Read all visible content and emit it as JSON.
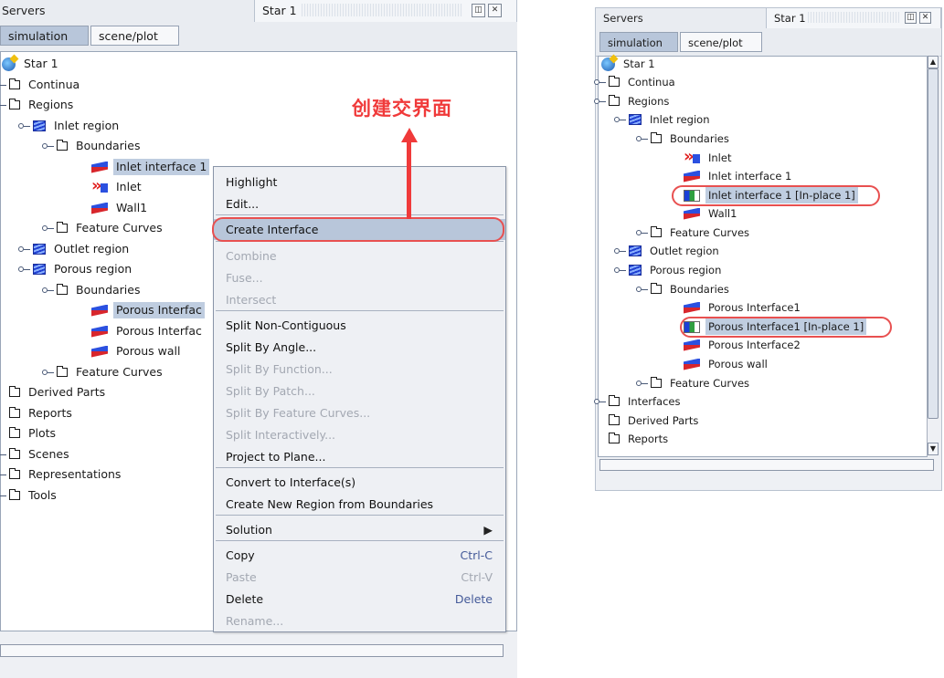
{
  "annotation": {
    "text": "创建交界面",
    "color": "#f03a3a"
  },
  "left": {
    "title": "Servers",
    "window_tab": "Star 1",
    "tabs": [
      "simulation",
      "scene/plot"
    ],
    "tree": [
      {
        "label": "Star 1",
        "icon": "star-sim-icon"
      },
      {
        "label": "Continua",
        "icon": "folder-icon"
      },
      {
        "label": "Regions",
        "icon": "folder-icon"
      },
      {
        "label": "Inlet region",
        "icon": "region-icon"
      },
      {
        "label": "Boundaries",
        "icon": "folder-icon"
      },
      {
        "label": "Inlet interface 1",
        "icon": "boundary-icon"
      },
      {
        "label": "Inlet",
        "icon": "inlet-icon"
      },
      {
        "label": "Wall1",
        "icon": "boundary-icon"
      },
      {
        "label": "Feature Curves",
        "icon": "folder-icon"
      },
      {
        "label": "Outlet region",
        "icon": "region-icon"
      },
      {
        "label": "Porous region",
        "icon": "region-icon"
      },
      {
        "label": "Boundaries",
        "icon": "folder-icon"
      },
      {
        "label": "Porous Interfac",
        "icon": "boundary-icon"
      },
      {
        "label": "Porous Interfac",
        "icon": "boundary-icon"
      },
      {
        "label": "Porous wall",
        "icon": "boundary-icon"
      },
      {
        "label": "Feature Curves",
        "icon": "folder-icon"
      },
      {
        "label": "Derived Parts",
        "icon": "folder-icon"
      },
      {
        "label": "Reports",
        "icon": "folder-icon"
      },
      {
        "label": "Plots",
        "icon": "folder-icon"
      },
      {
        "label": "Scenes",
        "icon": "folder-icon"
      },
      {
        "label": "Representations",
        "icon": "folder-icon"
      },
      {
        "label": "Tools",
        "icon": "folder-icon"
      }
    ]
  },
  "context_menu": {
    "items": [
      {
        "label": "Highlight",
        "enabled": true
      },
      {
        "label": "Edit...",
        "enabled": true
      },
      {
        "label": "Create Interface",
        "enabled": true,
        "highlighted": true
      },
      {
        "label": "Combine",
        "enabled": false
      },
      {
        "label": "Fuse...",
        "enabled": false
      },
      {
        "label": "Intersect",
        "enabled": false
      },
      {
        "label": "Split Non-Contiguous",
        "enabled": true
      },
      {
        "label": "Split By Angle...",
        "enabled": true
      },
      {
        "label": "Split By Function...",
        "enabled": false
      },
      {
        "label": "Split By Patch...",
        "enabled": false
      },
      {
        "label": "Split By Feature Curves...",
        "enabled": false
      },
      {
        "label": "Split Interactively...",
        "enabled": false
      },
      {
        "label": "Project to Plane...",
        "enabled": true
      },
      {
        "label": "Convert to Interface(s)",
        "enabled": true
      },
      {
        "label": "Create New Region from Boundaries",
        "enabled": true
      },
      {
        "label": "Solution",
        "enabled": true,
        "submenu": "▶"
      },
      {
        "label": "Copy",
        "enabled": true,
        "shortcut": "Ctrl-C"
      },
      {
        "label": "Paste",
        "enabled": false,
        "shortcut": "Ctrl-V"
      },
      {
        "label": "Delete",
        "enabled": true,
        "shortcut": "Delete"
      },
      {
        "label": "Rename...",
        "enabled": false
      }
    ]
  },
  "right": {
    "title": "Servers",
    "window_tab": "Star 1",
    "tabs": [
      "simulation",
      "scene/plot"
    ],
    "tree": [
      {
        "label": "Star 1",
        "icon": "star-sim-icon"
      },
      {
        "label": "Continua",
        "icon": "folder-icon"
      },
      {
        "label": "Regions",
        "icon": "folder-icon"
      },
      {
        "label": "Inlet region",
        "icon": "region-icon"
      },
      {
        "label": "Boundaries",
        "icon": "folder-icon"
      },
      {
        "label": "Inlet",
        "icon": "inlet-icon"
      },
      {
        "label": "Inlet interface 1",
        "icon": "boundary-icon"
      },
      {
        "label": "Inlet interface 1 [In-place 1]",
        "icon": "interface-icon"
      },
      {
        "label": "Wall1",
        "icon": "boundary-icon"
      },
      {
        "label": "Feature Curves",
        "icon": "folder-icon"
      },
      {
        "label": "Outlet region",
        "icon": "region-icon"
      },
      {
        "label": "Porous region",
        "icon": "region-icon"
      },
      {
        "label": "Boundaries",
        "icon": "folder-icon"
      },
      {
        "label": "Porous Interface1",
        "icon": "boundary-icon"
      },
      {
        "label": "Porous Interface1 [In-place 1]",
        "icon": "interface-icon"
      },
      {
        "label": "Porous Interface2",
        "icon": "boundary-icon"
      },
      {
        "label": "Porous wall",
        "icon": "boundary-icon"
      },
      {
        "label": "Feature Curves",
        "icon": "folder-icon"
      },
      {
        "label": "Interfaces",
        "icon": "folder-icon"
      },
      {
        "label": "Derived Parts",
        "icon": "folder-icon"
      },
      {
        "label": "Reports",
        "icon": "folder-icon"
      }
    ]
  }
}
